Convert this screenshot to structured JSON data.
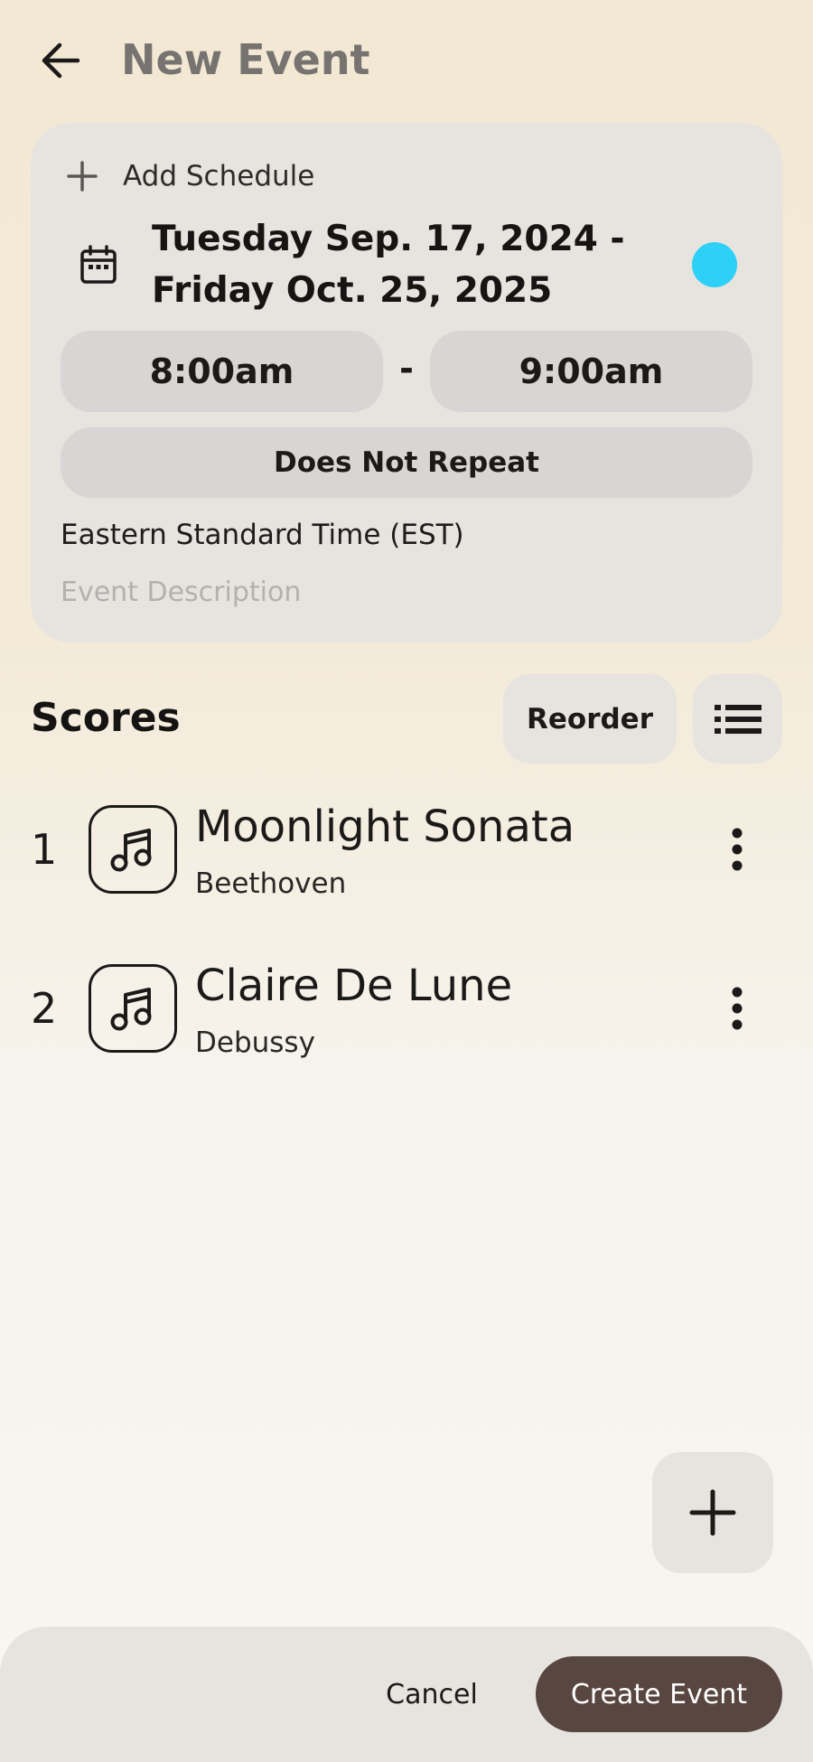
{
  "header": {
    "back_icon": "arrow-left-icon",
    "title": "New Event"
  },
  "schedule": {
    "add_icon": "plus-icon",
    "add_label": "Add Schedule",
    "calendar_icon": "calendar-icon",
    "date_line1": "Tuesday Sep. 17, 2024 -",
    "date_line2": "Friday Oct. 25, 2025",
    "color": "#2dd0f7",
    "start_time": "8:00am",
    "time_separator": "-",
    "end_time": "9:00am",
    "repeat": "Does Not Repeat",
    "timezone": "Eastern Standard Time (EST)",
    "description_value": "",
    "description_placeholder": "Event Description"
  },
  "scores": {
    "title": "Scores",
    "reorder_label": "Reorder",
    "list_icon": "list-icon",
    "items": [
      {
        "number": "1",
        "title": "Moonlight Sonata",
        "composer": "Beethoven",
        "icon": "music-note-icon",
        "menu_icon": "more-vertical-icon"
      },
      {
        "number": "2",
        "title": "Claire De Lune",
        "composer": "Debussy",
        "icon": "music-note-icon",
        "menu_icon": "more-vertical-icon"
      }
    ]
  },
  "fab": {
    "icon": "plus-icon"
  },
  "footer": {
    "cancel_label": "Cancel",
    "create_label": "Create Event",
    "create_color": "#584640"
  }
}
